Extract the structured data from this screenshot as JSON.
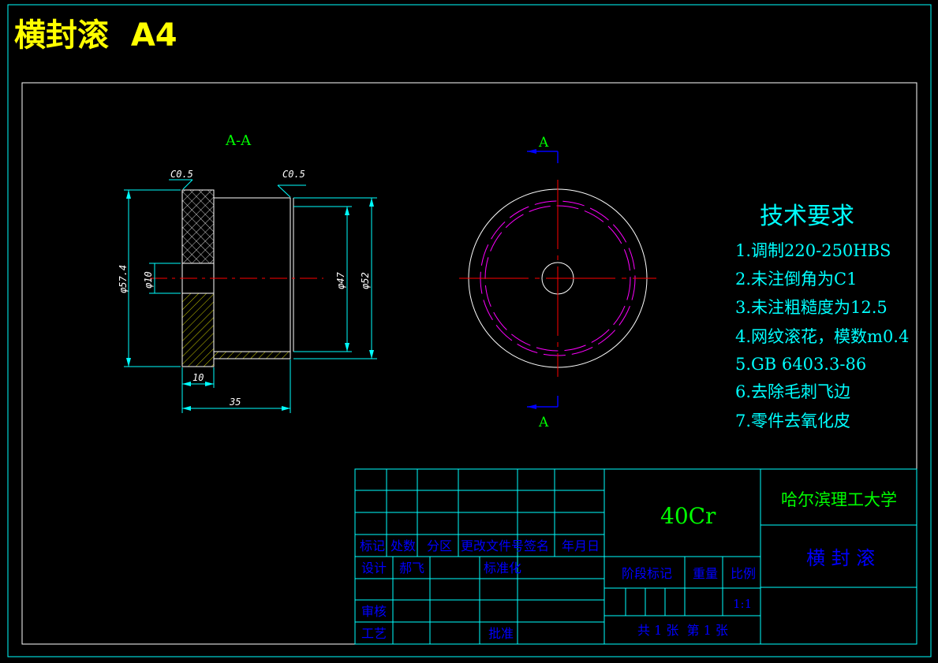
{
  "header": {
    "title": "横封滚  A4"
  },
  "section_view": {
    "label": "A-A",
    "chamfer_left": "C0.5",
    "chamfer_right": "C0.5",
    "dims": {
      "outer_dia": "φ57.4",
      "bore_dia": "φ10",
      "inner_dia": "φ47",
      "body_dia": "φ52",
      "flange_len": "10",
      "total_len": "35"
    }
  },
  "front_view": {
    "section_mark_top": "A",
    "section_mark_bottom": "A"
  },
  "tech_requirements": {
    "title": "技术要求",
    "items": [
      "1.调制220-250HBS",
      "2.未注倒角为C1",
      "3.未注粗糙度为12.5",
      "4.网纹滚花，模数m0.4",
      "5.GB 6403.3-86",
      "6.去除毛刺飞边",
      "7.零件去氧化皮"
    ]
  },
  "title_block": {
    "material": "40Cr",
    "school": "哈尔滨理工大学",
    "part_name": "横 封 滚",
    "headers": {
      "mark": "标记",
      "count": "处数",
      "zone": "分区",
      "doc": "更改文件号",
      "sign": "签名",
      "date": "年月日"
    },
    "design_label": "设计",
    "designer": "郝飞",
    "standard_label": "标准化",
    "review_label": "审核",
    "process_label": "工艺",
    "approve_label": "批准",
    "stage_label": "阶段标记",
    "weight_label": "重量",
    "scale_label": "比例",
    "scale_value": "1:1",
    "sheets": "共 1 张  第 1 张"
  },
  "colors": {
    "background": "#000000",
    "frame": "#00ffff",
    "title": "#ffff00",
    "green": "#00ff00",
    "cyan": "#00ffff",
    "blue": "#0000ff",
    "red": "#ff0000",
    "magenta": "#ff00ff",
    "white": "#ffffff"
  }
}
